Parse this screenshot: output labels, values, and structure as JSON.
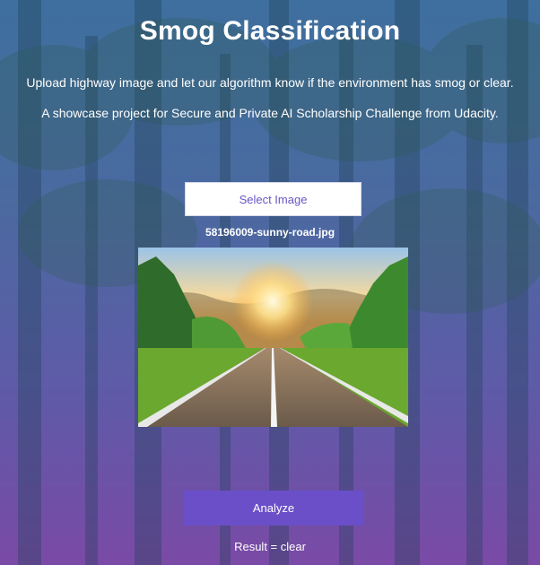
{
  "header": {
    "title": "Smog Classification",
    "description": "Upload highway image and let our algorithm know if the environment has smog or clear.",
    "tagline": "A showcase project for Secure and Private AI Scholarship Challenge from Udacity."
  },
  "upload": {
    "select_label": "Select Image",
    "filename": "58196009-sunny-road.jpg"
  },
  "analyze": {
    "button_label": "Analyze",
    "result_text": "Result = clear"
  },
  "colors": {
    "accent": "#6a4fc8",
    "select_text": "#6a55c6"
  }
}
